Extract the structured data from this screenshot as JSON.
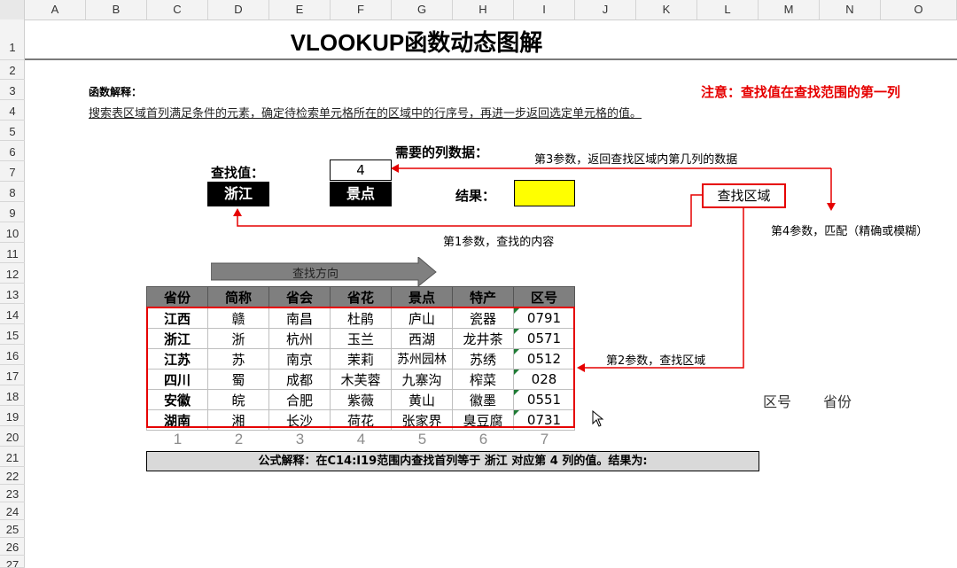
{
  "columns": [
    "A",
    "B",
    "C",
    "D",
    "E",
    "F",
    "G",
    "H",
    "I",
    "J",
    "K",
    "L",
    "M",
    "N",
    "O"
  ],
  "rows": [
    "1",
    "2",
    "3",
    "4",
    "5",
    "6",
    "7",
    "8",
    "9",
    "10",
    "11",
    "12",
    "13",
    "14",
    "15",
    "16",
    "17",
    "18",
    "19",
    "20",
    "21",
    "22",
    "23",
    "24",
    "25",
    "26",
    "27"
  ],
  "title": "VLOOKUP函数动态图解",
  "explanation": {
    "heading": "函数解释：",
    "body": "搜索表区域首列满足条件的元素，确定待检索单元格所在的区域中的行序号，再进一步返回选定单元格的值。"
  },
  "note": "注意：查找值在查找范围的第一列",
  "lookup": {
    "label": "查找值：",
    "value": "浙江"
  },
  "column_needed": {
    "label": "需要的列数据：",
    "number": "4",
    "name": "景点"
  },
  "result": {
    "label": "结果：",
    "value": ""
  },
  "range_label": "查找区域",
  "annotations": {
    "param3": "第3参数，返回查找区域内第几列的数据",
    "param1": "第1参数，查找的内容",
    "param4": "第4参数，匹配（精确或模糊）",
    "param2": "第2参数，查找区域",
    "direction": "查找方向"
  },
  "table": {
    "headers": [
      "省份",
      "简称",
      "省会",
      "省花",
      "景点",
      "特产",
      "区号"
    ],
    "rows": [
      [
        "江西",
        "赣",
        "南昌",
        "杜鹃",
        "庐山",
        "瓷器",
        "0791"
      ],
      [
        "浙江",
        "浙",
        "杭州",
        "玉兰",
        "西湖",
        "龙井茶",
        "0571"
      ],
      [
        "江苏",
        "苏",
        "南京",
        "茉莉",
        "苏州园林",
        "苏绣",
        "0512"
      ],
      [
        "四川",
        "蜀",
        "成都",
        "木芙蓉",
        "九寨沟",
        "榨菜",
        "028"
      ],
      [
        "安徽",
        "皖",
        "合肥",
        "紫薇",
        "黄山",
        "徽墨",
        "0551"
      ],
      [
        "湖南",
        "湘",
        "长沙",
        "荷花",
        "张家界",
        "臭豆腐",
        "0731"
      ]
    ]
  },
  "column_indexes": [
    "1",
    "2",
    "3",
    "4",
    "5",
    "6",
    "7"
  ],
  "side_labels": {
    "area_code": "区号",
    "province": "省份"
  },
  "formula_explanation": "公式解释：在C14:I19范围内查找首列等于 浙江 对应第 4 列的值。结果为:",
  "colors": {
    "red": "#e60000",
    "result_fill": "#ffff00",
    "header_fill": "#7f7f7f",
    "arrow_fill": "#808080"
  }
}
